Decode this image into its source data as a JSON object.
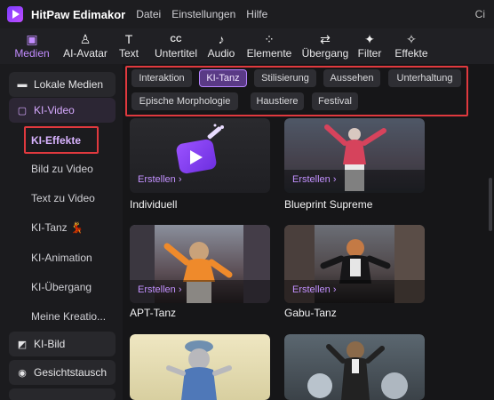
{
  "app": {
    "title": "HitPaw Edimakor"
  },
  "menu": [
    "Datei",
    "Einstellungen",
    "Hilfe"
  ],
  "titlebar_right": "Ci",
  "toolbar": [
    {
      "label": "Medien",
      "icon": "image-icon",
      "glyph": "▣",
      "active": true
    },
    {
      "label": "AI-Avatar",
      "icon": "avatar-icon",
      "glyph": "♙",
      "active": false
    },
    {
      "label": "Text",
      "icon": "text-icon",
      "glyph": "T",
      "active": false
    },
    {
      "label": "Untertitel",
      "icon": "subtitle-icon",
      "glyph": "CC",
      "active": false
    },
    {
      "label": "Audio",
      "icon": "music-icon",
      "glyph": "♪",
      "active": false
    },
    {
      "label": "Elemente",
      "icon": "elements-icon",
      "glyph": "⁘",
      "active": false
    },
    {
      "label": "Übergang",
      "icon": "transition-icon",
      "glyph": "⇄",
      "active": false
    },
    {
      "label": "Filter",
      "icon": "filter-icon",
      "glyph": "✦",
      "active": false
    },
    {
      "label": "Effekte",
      "icon": "effects-icon",
      "glyph": "✧",
      "active": false
    }
  ],
  "sidebar": {
    "sections": [
      {
        "label": "Lokale Medien",
        "icon": "folder-icon",
        "glyph": "▬"
      },
      {
        "label": "KI-Video",
        "icon": "ai-video-icon",
        "glyph": "▢"
      },
      {
        "label": "KI-Bild",
        "icon": "ai-image-icon",
        "glyph": "◩"
      },
      {
        "label": "Gesichtstausch",
        "icon": "face-swap-icon",
        "glyph": "◉"
      }
    ],
    "sub_items": [
      "KI-Effekte",
      "Bild zu Video",
      "Text zu Video",
      "KI-Tanz 💃",
      "KI-Animation",
      "KI-Übergang",
      "Meine Kreatio..."
    ]
  },
  "filters": [
    "Interaktion",
    "KI-Tanz",
    "Stilisierung",
    "Aussehen",
    "Unterhaltung",
    "Epische Morphologie",
    "Haustiere",
    "Festival"
  ],
  "active_filter": "KI-Tanz",
  "cards": [
    {
      "title": "Individuell",
      "action": "Erstellen ›"
    },
    {
      "title": "Blueprint Supreme",
      "action": "Erstellen ›"
    },
    {
      "title": "APT-Tanz",
      "action": "Erstellen ›"
    },
    {
      "title": "Gabu-Tanz",
      "action": "Erstellen ›"
    }
  ],
  "colors": {
    "accent": "#c28cff",
    "highlight_box": "#e0393e",
    "chip_active": "#5a3a86"
  }
}
